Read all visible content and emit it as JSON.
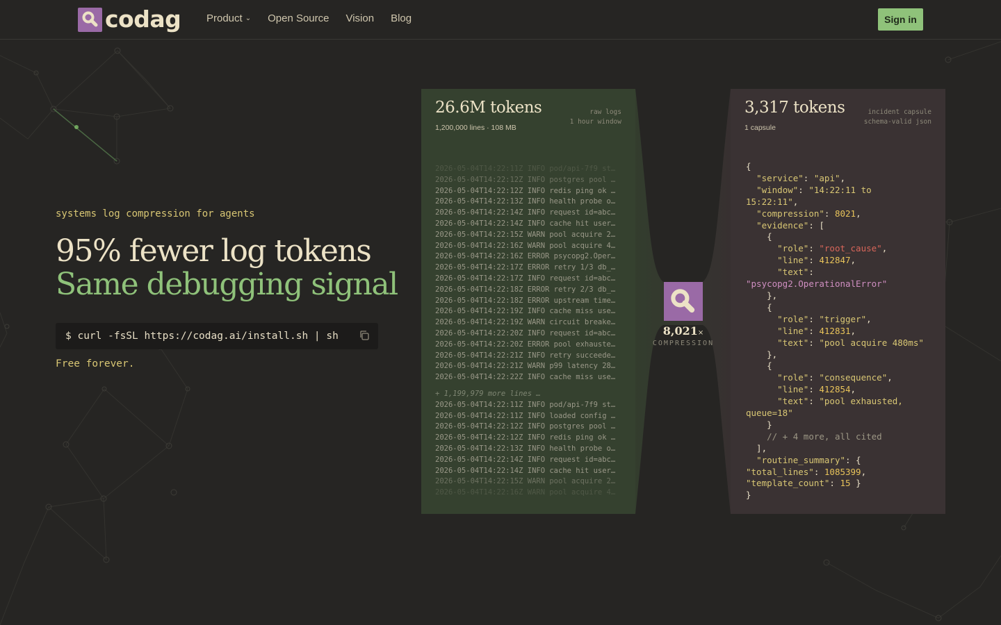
{
  "brand": {
    "name": "codag",
    "mark_color": "#9a6aa6"
  },
  "nav": {
    "items": [
      {
        "label": "Product",
        "has_dropdown": true
      },
      {
        "label": "Open Source"
      },
      {
        "label": "Vision"
      },
      {
        "label": "Blog"
      }
    ],
    "signin_label": "Sign in"
  },
  "hero": {
    "tagline": "systems log compression for agents",
    "headline_1": "95% fewer log tokens",
    "headline_2": "Same debugging signal",
    "install_command": "$ curl -fsSL https://codag.ai/install.sh | sh",
    "note": "Free forever."
  },
  "raw_panel": {
    "title": "26.6M tokens",
    "subtitle": "1,200,000 lines · 108 MB",
    "meta_1": "raw logs",
    "meta_2": "1 hour window",
    "lines_top": [
      "2026-05-04T14:22:11Z INFO pod/api-7f9 st…",
      "2026-05-04T14:22:12Z INFO postgres pool …",
      "2026-05-04T14:22:12Z INFO redis ping ok …",
      "2026-05-04T14:22:13Z INFO health probe o…",
      "2026-05-04T14:22:14Z INFO request id=abc…",
      "2026-05-04T14:22:14Z INFO cache hit user…",
      "2026-05-04T14:22:15Z WARN pool acquire 2…",
      "2026-05-04T14:22:16Z WARN pool acquire 4…",
      "2026-05-04T14:22:16Z ERROR psycopg2.Oper…",
      "2026-05-04T14:22:17Z ERROR retry 1/3 db_…",
      "2026-05-04T14:22:17Z INFO request id=abc…",
      "2026-05-04T14:22:18Z ERROR retry 2/3 db_…",
      "2026-05-04T14:22:18Z ERROR upstream time…",
      "2026-05-04T14:22:19Z INFO cache miss use…",
      "2026-05-04T14:22:19Z WARN circuit breake…",
      "2026-05-04T14:22:20Z INFO request id=abc…",
      "2026-05-04T14:22:20Z ERROR pool exhauste…",
      "2026-05-04T14:22:21Z INFO retry succeede…",
      "2026-05-04T14:22:21Z WARN p99 latency 28…",
      "2026-05-04T14:22:22Z INFO cache miss use…"
    ],
    "more_lines": "+ 1,199,979 more lines …",
    "lines_bottom": [
      "2026-05-04T14:22:11Z INFO pod/api-7f9 st…",
      "2026-05-04T14:22:11Z INFO loaded config …",
      "2026-05-04T14:22:12Z INFO postgres pool …",
      "2026-05-04T14:22:12Z INFO redis ping ok …",
      "2026-05-04T14:22:13Z INFO health probe o…",
      "2026-05-04T14:22:14Z INFO request id=abc…",
      "2026-05-04T14:22:14Z INFO cache hit user…",
      "2026-05-04T14:22:15Z WARN pool acquire 2…",
      "2026-05-04T14:22:16Z WARN pool acquire 4…"
    ]
  },
  "compression": {
    "value": "8,021",
    "suffix": "×",
    "label": "COMPRESSION"
  },
  "capsule_panel": {
    "title": "3,317 tokens",
    "subtitle": "1 capsule",
    "meta_1": "incident capsule",
    "meta_2": "schema-valid json",
    "json": {
      "service": "api",
      "window_a": "14:22:11 to",
      "window_b": "15:22:11",
      "compression": "8021",
      "evidence": [
        {
          "role": "root_cause",
          "line": "412847",
          "text": "psycopg2.OperationalError"
        },
        {
          "role": "trigger",
          "line": "412831",
          "text": "pool acquire 480ms"
        },
        {
          "role": "consequence",
          "line": "412854",
          "text_a": "pool exhausted,",
          "text_b": "queue=18"
        }
      ],
      "comment": "// + 4 more, all cited",
      "total_lines": "1085399",
      "template_count": "15"
    }
  },
  "colors": {
    "accent_green": "#8fc27a",
    "accent_yellow": "#d9c774",
    "bg": "#262523"
  }
}
